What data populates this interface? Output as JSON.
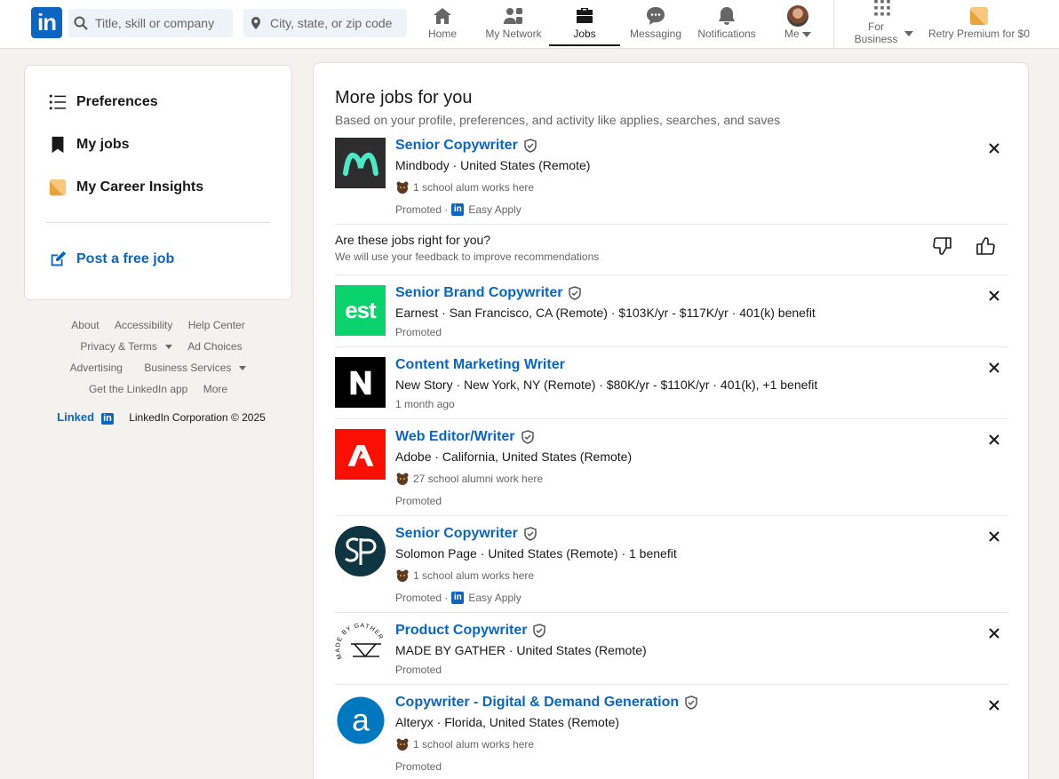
{
  "nav": {
    "search_title_placeholder": "Title, skill or company",
    "search_location_placeholder": "City, state, or zip code",
    "items": [
      {
        "label": "Home"
      },
      {
        "label": "My Network"
      },
      {
        "label": "Jobs"
      },
      {
        "label": "Messaging"
      },
      {
        "label": "Notifications"
      },
      {
        "label": "Me"
      }
    ],
    "for_business_line1": "For",
    "for_business_line2": "Business",
    "premium": "Retry Premium for $0"
  },
  "sidebar": {
    "items": [
      {
        "label": "Preferences"
      },
      {
        "label": "My jobs"
      },
      {
        "label": "My Career Insights"
      }
    ],
    "post_job": "Post a free job"
  },
  "footer": {
    "links": [
      "About",
      "Accessibility",
      "Help Center",
      "Privacy & Terms",
      "Ad Choices",
      "Advertising",
      "Business Services",
      "Get the LinkedIn app",
      "More"
    ],
    "logo_text": "Linked",
    "logo_in": "in",
    "copyright": "LinkedIn Corporation © 2025"
  },
  "main": {
    "title": "More jobs for you",
    "subtitle": "Based on your profile, preferences, and activity like applies, searches, and saves",
    "feedback_question": "Are these jobs right for you?",
    "feedback_sub": "We will use your feedback to improve recommendations",
    "jobs": [
      {
        "title": "Senior Copywriter",
        "company": "Mindbody · United States (Remote)",
        "alum": "1 school alum works here",
        "meta": "Promoted ·",
        "easy_apply": "Easy Apply"
      },
      {
        "title": "Senior Brand Copywriter",
        "company": "Earnest · San Francisco, CA (Remote) · $103K/yr - $117K/yr · 401(k) benefit",
        "meta": "Promoted"
      },
      {
        "title": "Content Marketing Writer",
        "company": "New Story · New York, NY (Remote) · $80K/yr - $110K/yr · 401(k), +1 benefit",
        "meta": "1 month ago"
      },
      {
        "title": "Web Editor/Writer",
        "company": "Adobe · California, United States (Remote)",
        "alum": "27 school alumni work here",
        "meta": "Promoted"
      },
      {
        "title": "Senior Copywriter",
        "company": "Solomon Page · United States (Remote) · 1 benefit",
        "alum": "1 school alum works here",
        "meta": "Promoted ·",
        "easy_apply": "Easy Apply"
      },
      {
        "title": "Product Copywriter",
        "company": "MADE BY GATHER · United States (Remote)",
        "meta": "Promoted"
      },
      {
        "title": "Copywriter - Digital & Demand Generation",
        "company": "Alteryx · Florida, United States (Remote)",
        "alum": "1 school alum works here",
        "meta": "Promoted"
      }
    ],
    "logos": {
      "earnest": "est",
      "gather_top": "MADE BY GATHER",
      "alteryx": "a"
    }
  },
  "colors": {
    "brand": "#0a66c2",
    "mindbody": "#2d2d2d",
    "earnest": "#0ad26c",
    "adobe": "#fa0f00",
    "solomon": "#0f3542",
    "alteryx": "#0078c0"
  }
}
